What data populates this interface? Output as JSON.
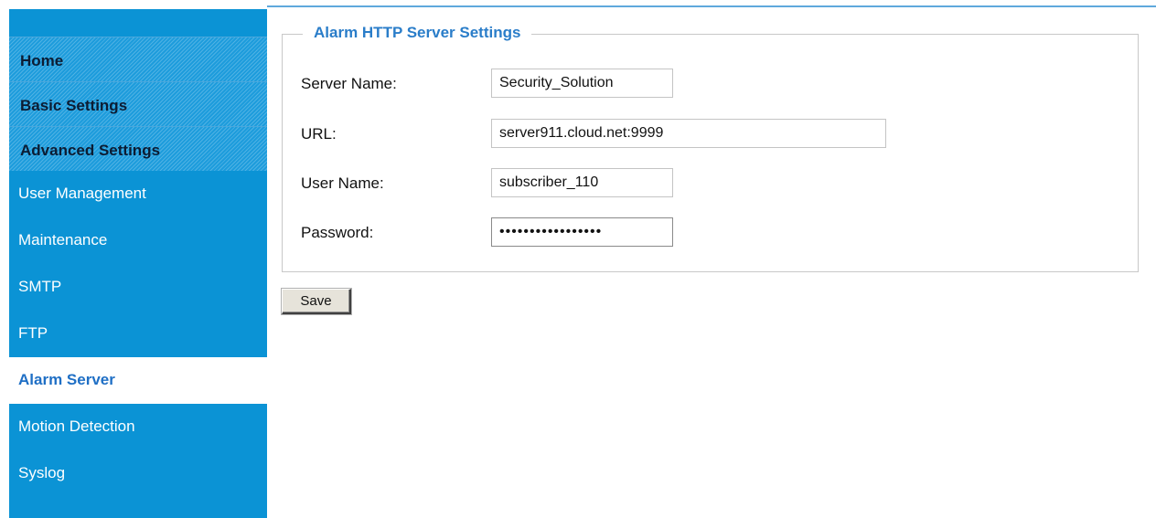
{
  "sidebar": {
    "main_items": [
      {
        "label": "Home"
      },
      {
        "label": "Basic Settings"
      },
      {
        "label": "Advanced Settings"
      }
    ],
    "sub_items": [
      {
        "label": "User Management"
      },
      {
        "label": "Maintenance"
      },
      {
        "label": "SMTP"
      },
      {
        "label": "FTP"
      },
      {
        "label": "Alarm Server"
      },
      {
        "label": "Motion Detection"
      },
      {
        "label": "Syslog"
      }
    ],
    "active_item": "Alarm Server"
  },
  "form": {
    "title": "Alarm HTTP Server Settings",
    "fields": [
      {
        "label": "Server Name:",
        "value": "Security_Solution"
      },
      {
        "label": "URL:",
        "value": "server911.cloud.net:9999"
      },
      {
        "label": "User Name:",
        "value": "subscriber_110"
      },
      {
        "label": "Password:",
        "value": "•••••••••••••••••"
      }
    ]
  },
  "actions": {
    "save_label": "Save"
  },
  "colors": {
    "sidebar": "#0b93d5",
    "accent_title": "#2a7dc9",
    "active_text": "#1f6fc5"
  }
}
